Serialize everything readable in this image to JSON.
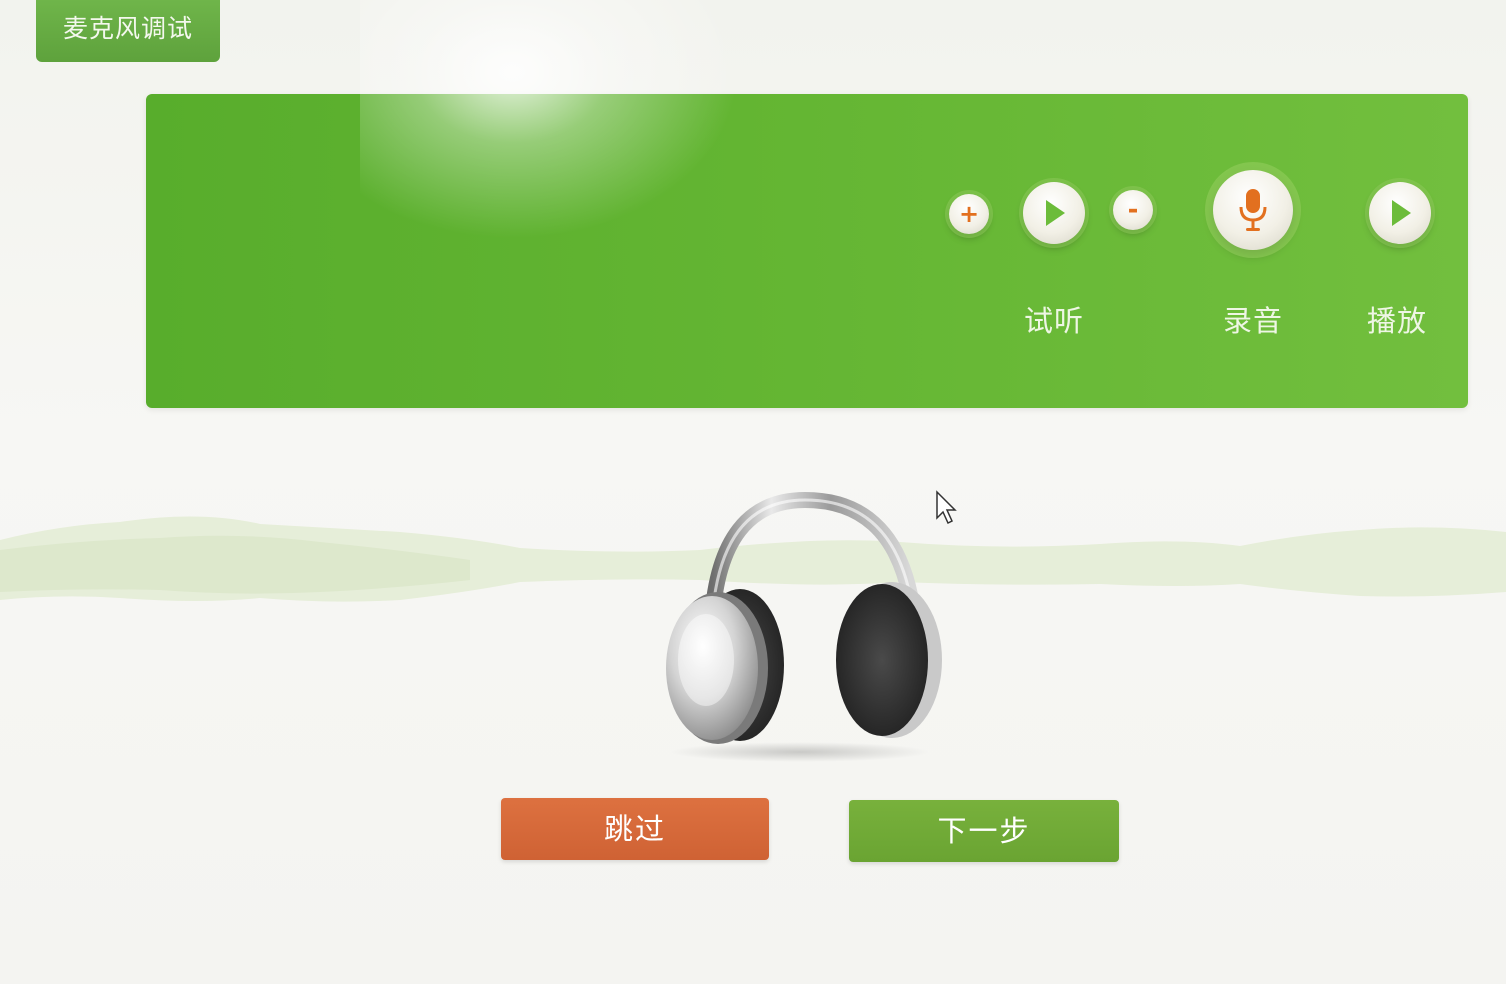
{
  "window": {
    "title": "麦克风调试"
  },
  "controls": {
    "volume_up_symbol": "+",
    "volume_down_symbol": "-",
    "listen_label": "试听",
    "record_label": "录音",
    "play_label": "播放"
  },
  "buttons": {
    "skip_label": "跳过",
    "next_label": "下一步"
  },
  "icons": {
    "volume_up": "plus-icon",
    "listen": "play-icon",
    "volume_down": "minus-icon",
    "record": "microphone-icon",
    "play": "play-icon",
    "illustration": "headphones-icon",
    "pointer": "mouse-cursor-icon"
  },
  "colors": {
    "panel_green": "#63b532",
    "title_green": "#66ab42",
    "skip_orange": "#d66a39",
    "next_green": "#72ab38",
    "mic_orange": "#e2701f",
    "play_green": "#6cbc3a"
  }
}
